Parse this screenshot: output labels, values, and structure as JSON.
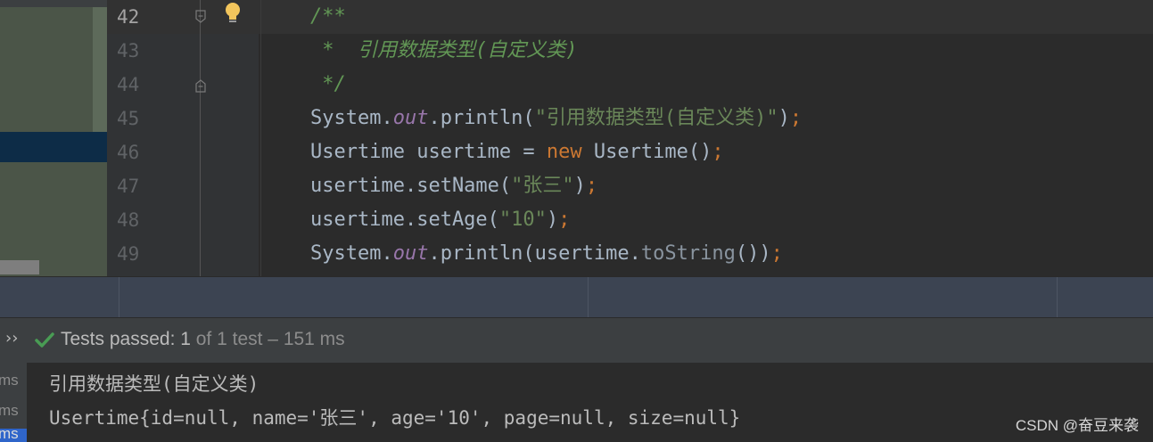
{
  "editor": {
    "lines": [
      {
        "num": "42",
        "segments": [
          {
            "t": "/**",
            "c": "c-comment"
          }
        ]
      },
      {
        "num": "43",
        "segments": [
          {
            "t": " *  引用数据类型(自定义类)",
            "c": "c-comment"
          }
        ]
      },
      {
        "num": "44",
        "segments": [
          {
            "t": " */",
            "c": "c-comment"
          }
        ]
      },
      {
        "num": "45",
        "segments": [
          {
            "t": "System.",
            "c": ""
          },
          {
            "t": "out",
            "c": "c-field"
          },
          {
            "t": ".println(",
            "c": ""
          },
          {
            "t": "\"引用数据类型(自定义类)\"",
            "c": "c-str"
          },
          {
            "t": ")",
            "c": ""
          },
          {
            "t": ";",
            "c": "c-semi"
          }
        ]
      },
      {
        "num": "46",
        "segments": [
          {
            "t": "Usertime usertime = ",
            "c": ""
          },
          {
            "t": "new",
            "c": "c-kw"
          },
          {
            "t": " Usertime()",
            "c": ""
          },
          {
            "t": ";",
            "c": "c-semi"
          }
        ]
      },
      {
        "num": "47",
        "segments": [
          {
            "t": "usertime.setName(",
            "c": ""
          },
          {
            "t": "\"张三\"",
            "c": "c-str"
          },
          {
            "t": ")",
            "c": ""
          },
          {
            "t": ";",
            "c": "c-semi"
          }
        ]
      },
      {
        "num": "48",
        "segments": [
          {
            "t": "usertime.setAge(",
            "c": ""
          },
          {
            "t": "\"10\"",
            "c": "c-str"
          },
          {
            "t": ")",
            "c": ""
          },
          {
            "t": ";",
            "c": "c-semi"
          }
        ]
      },
      {
        "num": "49",
        "segments": [
          {
            "t": "System.",
            "c": ""
          },
          {
            "t": "out",
            "c": "c-field"
          },
          {
            "t": ".println(usertime.",
            "c": ""
          },
          {
            "t": "toString",
            "c": "c-method-dim"
          },
          {
            "t": "())",
            "c": ""
          },
          {
            "t": ";",
            "c": "c-semi"
          }
        ]
      }
    ]
  },
  "run": {
    "expand_label": "››",
    "status_passed": "Tests passed: 1",
    "status_detail": " of 1 test – 151 ms"
  },
  "console": {
    "ms_labels": [
      "ms",
      "ms"
    ],
    "ms_selected": "ms",
    "output": [
      "引用数据类型(自定义类)",
      "Usertime{id=null, name='张三', age='10', page=null, size=null}"
    ]
  },
  "watermark": "CSDN @奋豆来袭",
  "colors": {
    "editor_bg": "#2b2b2b",
    "comment": "#629755",
    "string": "#6a8759",
    "keyword": "#cc7832",
    "field": "#9876aa",
    "pass_green": "#499c54"
  }
}
